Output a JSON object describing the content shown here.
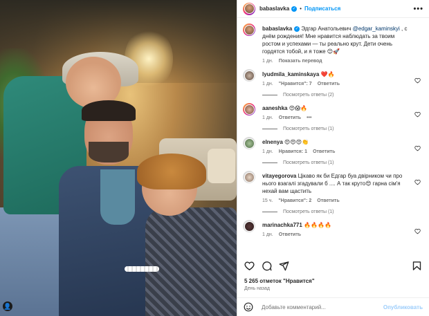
{
  "post": {
    "author": "babaslavka",
    "follow_label": "Подписаться",
    "more_label": "•••",
    "caption_prefix": "Эдгар Анатольевич ",
    "caption_mention": "@edgar_kaminskyi",
    "caption_suffix": " , с днём рождения! Мне нравится наблюдать за твоим ростом и успехами — ты реально крут. Дети очень гордятся тобой, и я тоже 😊🚀",
    "caption_time": "1 дн.",
    "caption_translate": "Показать перевод",
    "likes": "5 265 отметок \"Нравится\"",
    "posted_ago": "День назад",
    "comment_placeholder": "Добавьте комментарий...",
    "publish_label": "Опубликовать"
  },
  "comments": [
    {
      "user": "lyudmila_kaminskaya",
      "text": "❤️🔥",
      "time": "1 дн.",
      "likes": "\"Нравится\": 7",
      "reply": "Ответить",
      "view_replies": "Посмотреть ответы (2)"
    },
    {
      "user": "aaneshka",
      "text": "😍😱🔥",
      "time": "1 дн.",
      "likes": "",
      "reply": "Ответить",
      "more": "•••",
      "view_replies": "Посмотреть ответы (1)"
    },
    {
      "user": "elnenya",
      "text": "😍😍😍👏",
      "time": "1 дн.",
      "likes": "Нравится: 1",
      "reply": "Ответить",
      "view_replies": "Посмотреть ответы (1)"
    },
    {
      "user": "vitayegorova",
      "text": "Цікаво як би Едгар буа двірником чи про нього взагалі згадували б .... А так круто😍 гарна сім'я нехай вам щастить",
      "time": "15 ч.",
      "likes": "\"Нравится\": 2",
      "reply": "Ответить",
      "view_replies": "Посмотреть ответы (1)"
    },
    {
      "user": "marinachka771",
      "text": "🔥🔥🔥🔥",
      "time": "1 дн.",
      "likes": "",
      "reply": "Ответить",
      "view_replies": ""
    }
  ],
  "icons": {
    "verified": "verified-badge-icon",
    "heart": "heart-icon",
    "comment": "comment-icon",
    "share": "share-icon",
    "save": "bookmark-icon",
    "emoji": "emoji-icon"
  },
  "colors": {
    "accent": "#0095f6",
    "muted": "#737373"
  }
}
